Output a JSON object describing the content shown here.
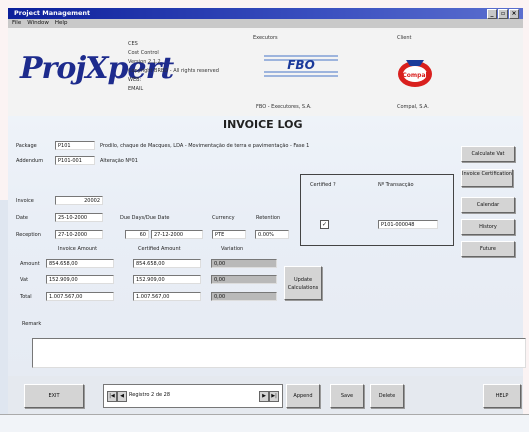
{
  "window": {
    "title": "Project Management",
    "controls": [
      "_",
      "▫",
      "×"
    ]
  },
  "menu": [
    "File",
    "Window",
    "Help"
  ],
  "header": {
    "logo_text": "ProjXpert",
    "app_info": [
      "CES",
      "Cost Control",
      "Version 2.1.2",
      "Copyright BRBD - All rights reserved",
      "WEB:",
      "EMAIL"
    ],
    "executors_label": "Executors",
    "executor_logo": "FBO",
    "executor_name": "FBO - Executores, S.A.",
    "client_label": "Client",
    "client_logo": "Compal",
    "client_name": "Compal, S.A."
  },
  "form": {
    "title": "INVOICE LOG",
    "package_label": "Package",
    "package_code": "P101",
    "package_desc": "Prodilo, chaque de Macques, LDA - Movimentação de terra e pavimentação - Fase 1",
    "addendum_label": "Addendum",
    "addendum_code": "P101-001",
    "addendum_desc": "Alteração Nº01",
    "invoice_label": "Invoice",
    "invoice_value": "20002",
    "date_label": "Date",
    "date_value": "25-10-2000",
    "reception_label": "Reception",
    "reception_value": "27-10-2000",
    "duedays_label": "Due Days/Due Date",
    "duedays_value": "60",
    "duedate_value": "27-12-2000",
    "currency_label": "Currency",
    "currency_value": "PTE",
    "retention_label": "Retention",
    "retention_value": "0.00%",
    "invoice_amount_label": "Invoice Amount",
    "certified_amount_label": "Certified Amount",
    "variation_label": "Variation",
    "amount_label": "Amount",
    "amount_invoice": "854.658,00",
    "amount_certified": "854.658,00",
    "amount_variation": "0,00",
    "vat_label": "Vat",
    "vat_invoice": "152.909,00",
    "vat_certified": "152.909,00",
    "vat_variation": "0,00",
    "total_label": "Total",
    "total_invoice": "1.007.567,00",
    "total_certified": "1.007.567,00",
    "total_variation": "0,00",
    "update_button": "Update Calculations",
    "certified_label": "Certified ?",
    "certified_checked": "✓",
    "nr_label": "Nº Transacção",
    "nr_value": "P101-000048",
    "remark_label": "Remark"
  },
  "side_buttons": [
    "Calculate Vat",
    "Invoice Certification",
    "Calendar",
    "History",
    "Future"
  ],
  "bottom": {
    "exit": "EXIT",
    "nav_first": "|◀",
    "nav_prev": "◀",
    "record_text": "Registro 2 de 28",
    "nav_next": "▶",
    "nav_last": "▶|",
    "append": "Append",
    "save": "Save",
    "delete": "Delete",
    "help": "HELP"
  },
  "colors": {
    "title_bar": "#0c1f9a",
    "logo": "#1d2b8d",
    "form_bg": "#e9eef6",
    "button": "#d4d4d4"
  }
}
